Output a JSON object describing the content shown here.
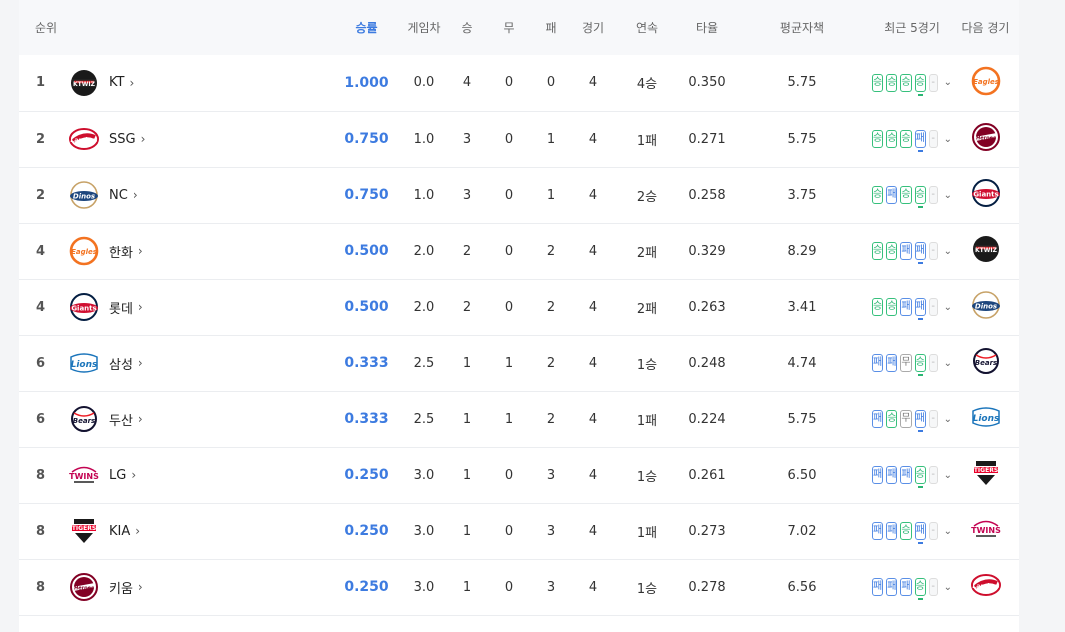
{
  "headers": {
    "rank": "순위",
    "pct": "승률",
    "gb": "게임차",
    "w": "승",
    "d": "무",
    "l": "패",
    "g": "경기",
    "streak": "연속",
    "avg": "타율",
    "era": "평균자책",
    "recent": "최근 5경기",
    "next": "다음 경기"
  },
  "result_labels": {
    "w": "승",
    "l": "패",
    "d": "무",
    "n": "-"
  },
  "icons": {
    "chevron": "chevron-right-icon",
    "dropdown": "chevron-down-icon"
  },
  "colors": {
    "accent": "#3d7be0",
    "win": "#2bb673",
    "loss": "#3d7be0",
    "draw": "#888888"
  },
  "rows": [
    {
      "rank": "1",
      "team": "KT",
      "logo": "kt",
      "pct": "1.000",
      "gb": "0.0",
      "w": "4",
      "d": "0",
      "l": "0",
      "g": "4",
      "streak": "4승",
      "avg": "0.350",
      "era": "5.75",
      "recent": [
        "w",
        "w",
        "w",
        "w",
        "n"
      ],
      "next": "hanwha"
    },
    {
      "rank": "2",
      "team": "SSG",
      "logo": "ssg",
      "pct": "0.750",
      "gb": "1.0",
      "w": "3",
      "d": "0",
      "l": "1",
      "g": "4",
      "streak": "1패",
      "avg": "0.271",
      "era": "5.75",
      "recent": [
        "w",
        "w",
        "w",
        "l",
        "n"
      ],
      "next": "kiwoom"
    },
    {
      "rank": "2",
      "team": "NC",
      "logo": "nc",
      "pct": "0.750",
      "gb": "1.0",
      "w": "3",
      "d": "0",
      "l": "1",
      "g": "4",
      "streak": "2승",
      "avg": "0.258",
      "era": "3.75",
      "recent": [
        "w",
        "l",
        "w",
        "w",
        "n"
      ],
      "next": "lotte"
    },
    {
      "rank": "4",
      "team": "한화",
      "logo": "hanwha",
      "pct": "0.500",
      "gb": "2.0",
      "w": "2",
      "d": "0",
      "l": "2",
      "g": "4",
      "streak": "2패",
      "avg": "0.329",
      "era": "8.29",
      "recent": [
        "w",
        "w",
        "l",
        "l",
        "n"
      ],
      "next": "kt"
    },
    {
      "rank": "4",
      "team": "롯데",
      "logo": "lotte",
      "pct": "0.500",
      "gb": "2.0",
      "w": "2",
      "d": "0",
      "l": "2",
      "g": "4",
      "streak": "2패",
      "avg": "0.263",
      "era": "3.41",
      "recent": [
        "w",
        "w",
        "l",
        "l",
        "n"
      ],
      "next": "nc"
    },
    {
      "rank": "6",
      "team": "삼성",
      "logo": "samsung",
      "pct": "0.333",
      "gb": "2.5",
      "w": "1",
      "d": "1",
      "l": "2",
      "g": "4",
      "streak": "1승",
      "avg": "0.248",
      "era": "4.74",
      "recent": [
        "l",
        "l",
        "d",
        "w",
        "n"
      ],
      "next": "doosan"
    },
    {
      "rank": "6",
      "team": "두산",
      "logo": "doosan",
      "pct": "0.333",
      "gb": "2.5",
      "w": "1",
      "d": "1",
      "l": "2",
      "g": "4",
      "streak": "1패",
      "avg": "0.224",
      "era": "5.75",
      "recent": [
        "l",
        "w",
        "d",
        "l",
        "n"
      ],
      "next": "samsung"
    },
    {
      "rank": "8",
      "team": "LG",
      "logo": "lg",
      "pct": "0.250",
      "gb": "3.0",
      "w": "1",
      "d": "0",
      "l": "3",
      "g": "4",
      "streak": "1승",
      "avg": "0.261",
      "era": "6.50",
      "recent": [
        "l",
        "l",
        "l",
        "w",
        "n"
      ],
      "next": "kia"
    },
    {
      "rank": "8",
      "team": "KIA",
      "logo": "kia",
      "pct": "0.250",
      "gb": "3.0",
      "w": "1",
      "d": "0",
      "l": "3",
      "g": "4",
      "streak": "1패",
      "avg": "0.273",
      "era": "7.02",
      "recent": [
        "l",
        "l",
        "w",
        "l",
        "n"
      ],
      "next": "lg"
    },
    {
      "rank": "8",
      "team": "키움",
      "logo": "kiwoom",
      "pct": "0.250",
      "gb": "3.0",
      "w": "1",
      "d": "0",
      "l": "3",
      "g": "4",
      "streak": "1승",
      "avg": "0.278",
      "era": "6.56",
      "recent": [
        "l",
        "l",
        "l",
        "w",
        "n"
      ],
      "next": "ssg"
    }
  ]
}
